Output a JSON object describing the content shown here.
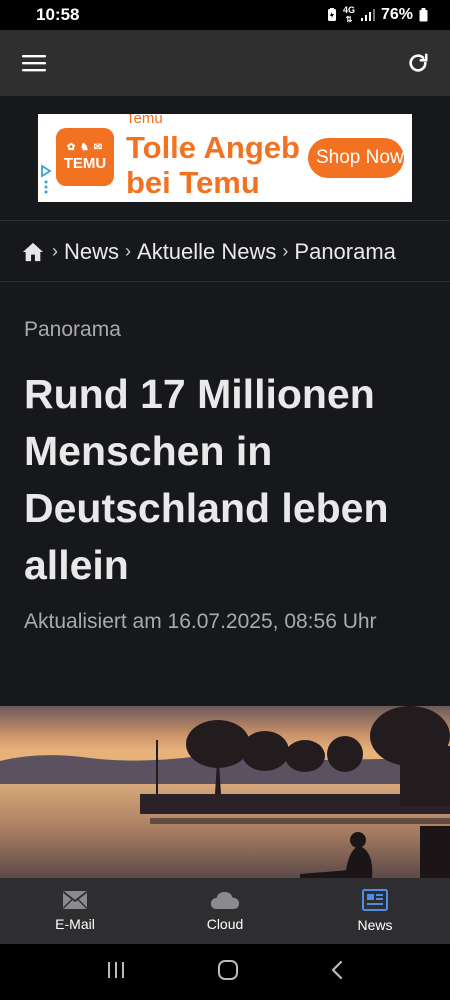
{
  "status_bar": {
    "time": "10:58",
    "network": "4G",
    "battery": "76%"
  },
  "app_bar": {
    "menu_icon": "hamburger-menu-icon",
    "refresh_icon": "refresh-icon"
  },
  "ad": {
    "logo_text": "TEMU",
    "brand_small": "Temu",
    "headline_line1": "Tolle Angeb",
    "headline_line2": "bei Temu",
    "cta": "Shop Now",
    "brand_color": "#f27221"
  },
  "breadcrumb": {
    "items": [
      "News",
      "Aktuelle News",
      "Panorama"
    ],
    "separator": "›"
  },
  "article": {
    "category": "Panorama",
    "title": "Rund 17 Millionen Menschen in Deutschland leben allein",
    "updated": "Aktualisiert am 16.07.2025, 08:56 Uhr"
  },
  "bottom_nav": {
    "items": [
      {
        "label": "E-Mail",
        "icon": "mail-icon"
      },
      {
        "label": "Cloud",
        "icon": "cloud-icon"
      },
      {
        "label": "News",
        "icon": "news-icon",
        "active": true
      }
    ]
  },
  "system_nav": {
    "icons": [
      "recents-icon",
      "home-icon",
      "back-icon"
    ]
  }
}
